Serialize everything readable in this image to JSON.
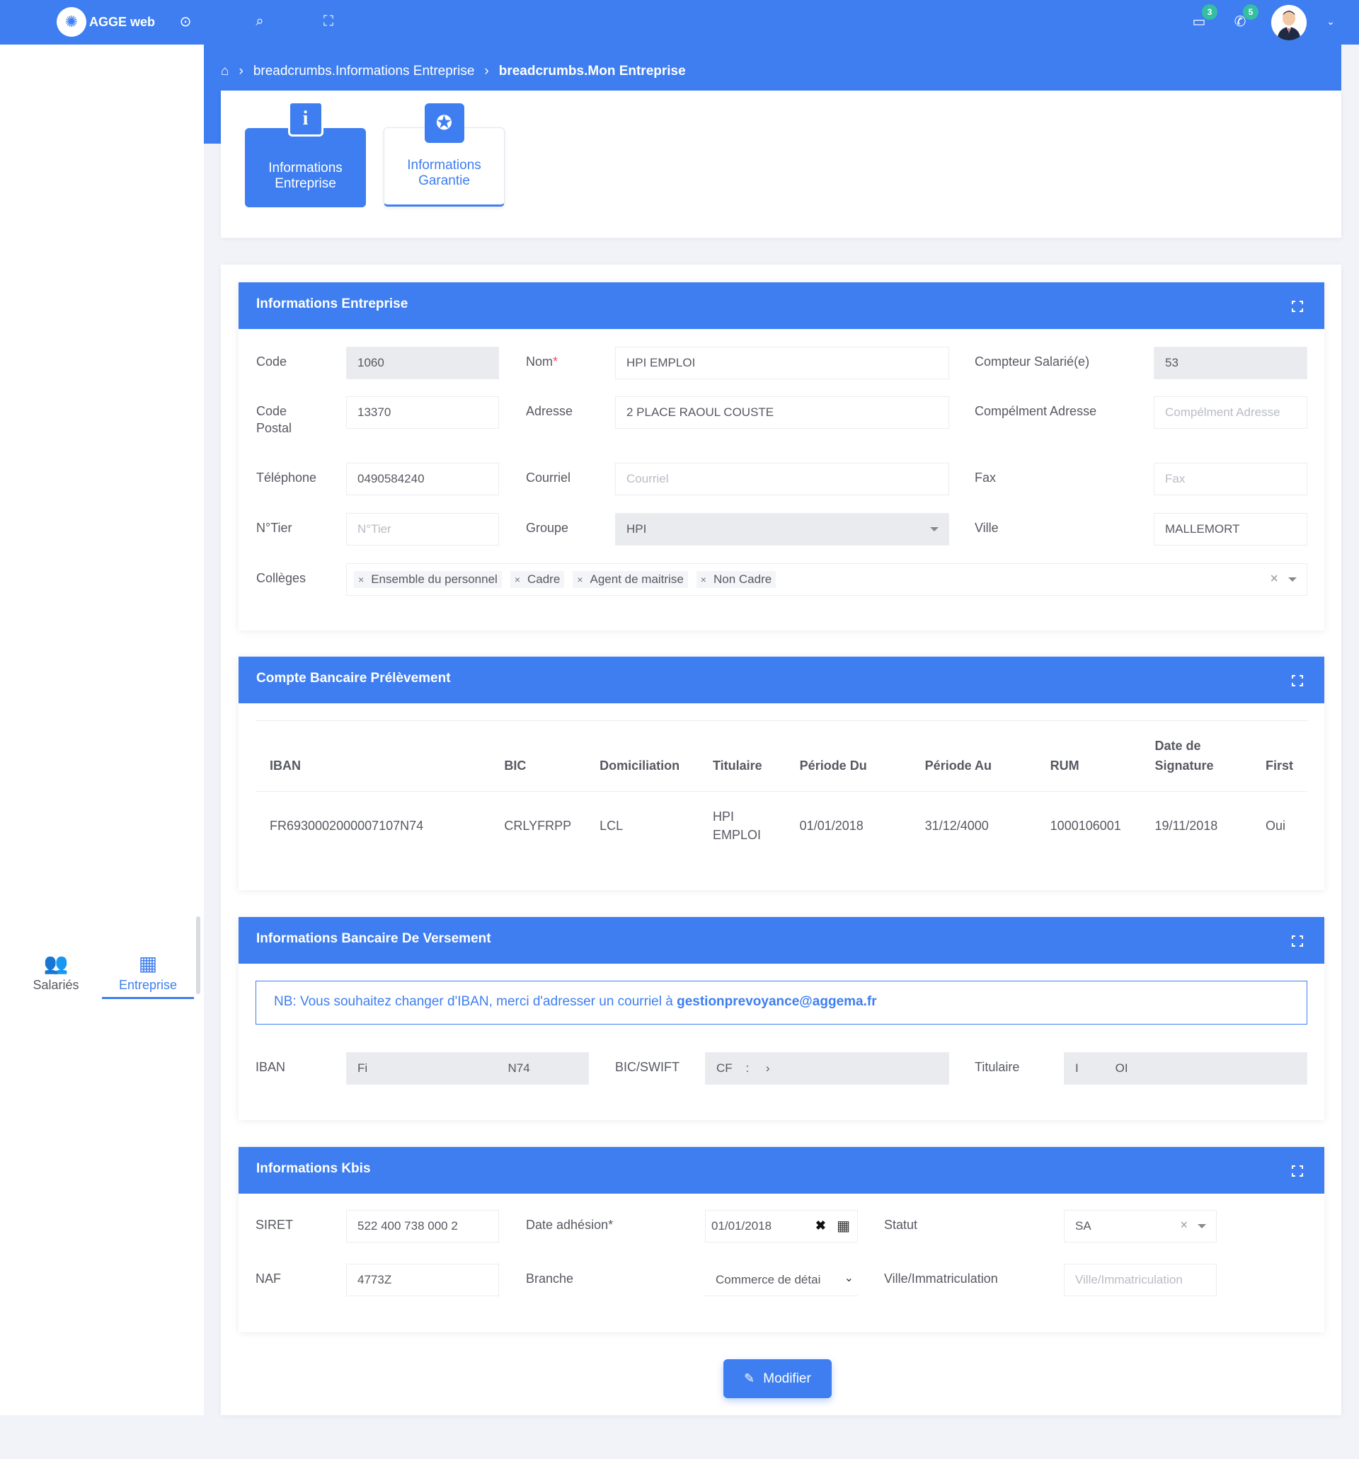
{
  "app": {
    "title": "AGGE web"
  },
  "topbar": {
    "messages_badge": "3",
    "calls_badge": "5"
  },
  "breadcrumb": {
    "item1": "breadcrumbs.Informations Entreprise",
    "item2": "breadcrumbs.Mon Entreprise"
  },
  "tabs": {
    "entreprise_line1": "Informations",
    "entreprise_line2": "Entreprise",
    "garantie_line1": "Informations",
    "garantie_line2": "Garantie"
  },
  "sidebar": {
    "salaries": "Salariés",
    "entreprise": "Entreprise"
  },
  "entreprise": {
    "title": "Informations Entreprise",
    "code_label": "Code",
    "code_value": "1060",
    "nom_label": "Nom",
    "nom_value": "HPI EMPLOI",
    "compteur_label": "Compteur Salarié(e)",
    "compteur_value": "53",
    "cp_label_1": "Code",
    "cp_label_2": "Postal",
    "cp_value": "13370",
    "adresse_label": "Adresse",
    "adresse_value": "2 PLACE RAOUL COUSTE",
    "complement_label": "Compélment Adresse",
    "complement_placeholder": "Compélment Adresse",
    "tel_label": "Téléphone",
    "tel_value": "0490584240",
    "courriel_label": "Courriel",
    "courriel_placeholder": "Courriel",
    "fax_label": "Fax",
    "fax_placeholder": "Fax",
    "ntier_label": "N°Tier",
    "ntier_placeholder": "N°Tier",
    "groupe_label": "Groupe",
    "groupe_value": "HPI",
    "ville_label": "Ville",
    "ville_value": "MALLEMORT",
    "colleges_label": "Collèges",
    "colleges": [
      "Ensemble du personnel",
      "Cadre",
      "Agent de maitrise",
      "Non Cadre"
    ]
  },
  "compte": {
    "title": "Compte Bancaire Prélèvement",
    "headers": {
      "iban": "IBAN",
      "bic": "BIC",
      "domiciliation": "Domiciliation",
      "titulaire": "Titulaire",
      "periode_du": "Période Du",
      "periode_au": "Période Au",
      "rum": "RUM",
      "date_sig_1": "Date de",
      "date_sig_2": "Signature",
      "first": "First"
    },
    "row": {
      "iban": "FR6930002000007107N74",
      "bic": "CRLYFRPP",
      "domiciliation": "LCL",
      "titulaire_1": "HPI",
      "titulaire_2": "EMPLOI",
      "periode_du": "01/01/2018",
      "periode_au": "31/12/4000",
      "rum": "1000106001",
      "date_sig": "19/11/2018",
      "first": "Oui"
    }
  },
  "versement": {
    "title": "Informations Bancaire De Versement",
    "notice_text": "NB: Vous souhaitez changer d'IBAN, merci d'adresser un courriel à ",
    "notice_email": "gestionprevoyance@aggema.fr",
    "iban_label": "IBAN",
    "iban_value": "Fi                                          N74",
    "bic_label": "BIC/SWIFT",
    "bic_value": "CF    :     ›",
    "titulaire_label": "Titulaire",
    "titulaire_value": "I           OI"
  },
  "kbis": {
    "title": "Informations Kbis",
    "siret_label": "SIRET",
    "siret_value": "522 400 738 000 2",
    "date_label": "Date adhésion*",
    "date_value": "01/01/2018",
    "statut_label": "Statut",
    "statut_value": "SA",
    "naf_label": "NAF",
    "naf_value": "4773Z",
    "branche_label": "Branche",
    "branche_value": "Commerce de détai",
    "ville_imm_label": "Ville/Immatriculation",
    "ville_imm_placeholder": "Ville/Immatriculation"
  },
  "actions": {
    "modifier": "Modifier"
  }
}
